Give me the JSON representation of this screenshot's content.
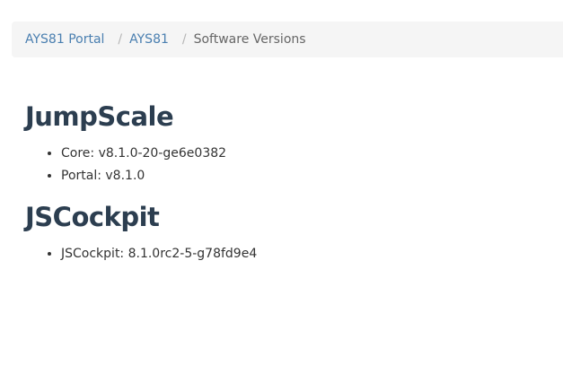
{
  "breadcrumb": {
    "items": [
      {
        "label": "AYS81 Portal"
      },
      {
        "label": "AYS81"
      }
    ],
    "separator": "/",
    "current": "Software Versions"
  },
  "sections": [
    {
      "title": "JumpScale",
      "items": [
        "Core: v8.1.0-20-ge6e0382",
        "Portal: v8.1.0"
      ]
    },
    {
      "title": "JSCockpit",
      "items": [
        "JSCockpit: 8.1.0rc2-5-g78fd9e4"
      ]
    }
  ],
  "colors": {
    "link": "#4a7fb0",
    "heading": "#2c3e50",
    "breadcrumb_bg": "#f5f5f5"
  }
}
